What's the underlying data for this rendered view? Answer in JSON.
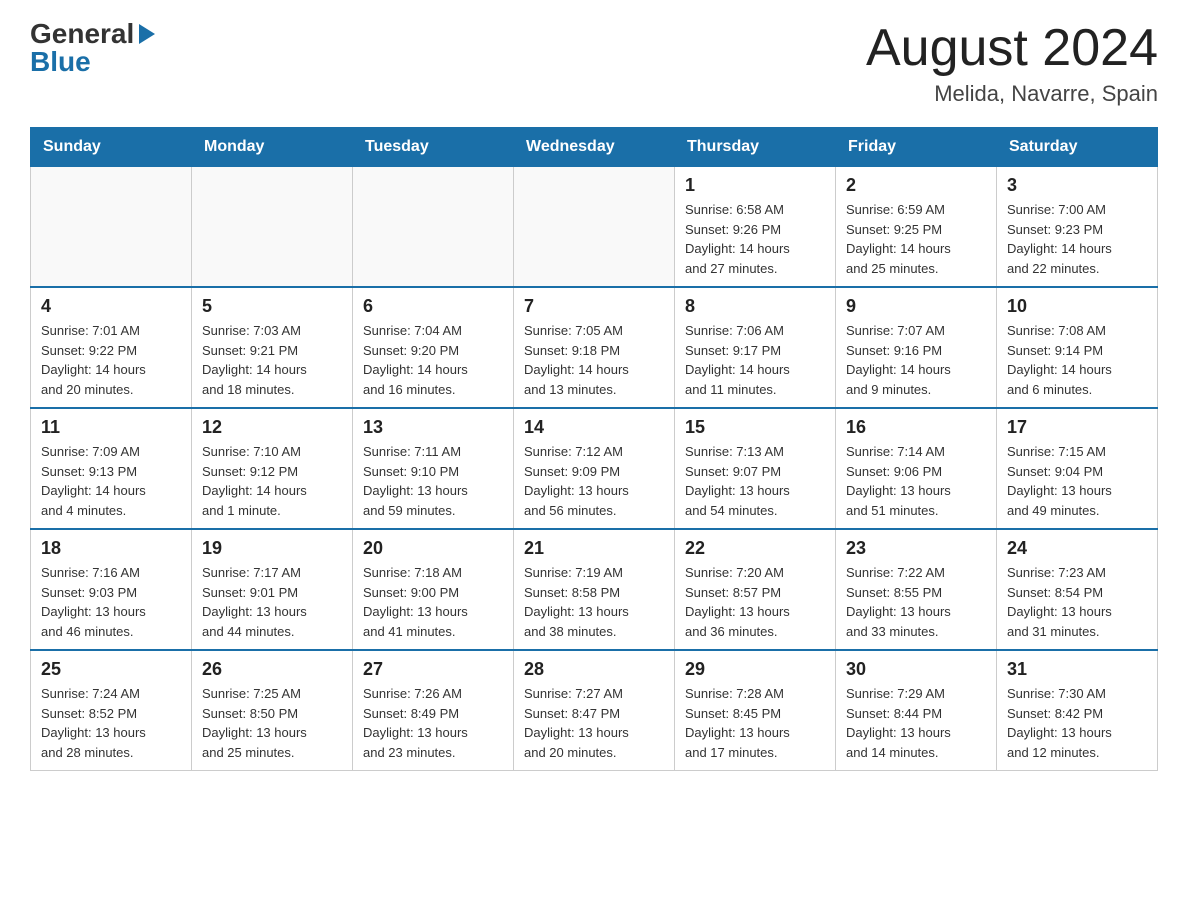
{
  "header": {
    "logo": {
      "general": "General",
      "blue": "Blue"
    },
    "title": "August 2024",
    "location": "Melida, Navarre, Spain"
  },
  "weekdays": [
    "Sunday",
    "Monday",
    "Tuesday",
    "Wednesday",
    "Thursday",
    "Friday",
    "Saturday"
  ],
  "weeks": [
    [
      {
        "day": "",
        "info": ""
      },
      {
        "day": "",
        "info": ""
      },
      {
        "day": "",
        "info": ""
      },
      {
        "day": "",
        "info": ""
      },
      {
        "day": "1",
        "info": "Sunrise: 6:58 AM\nSunset: 9:26 PM\nDaylight: 14 hours\nand 27 minutes."
      },
      {
        "day": "2",
        "info": "Sunrise: 6:59 AM\nSunset: 9:25 PM\nDaylight: 14 hours\nand 25 minutes."
      },
      {
        "day": "3",
        "info": "Sunrise: 7:00 AM\nSunset: 9:23 PM\nDaylight: 14 hours\nand 22 minutes."
      }
    ],
    [
      {
        "day": "4",
        "info": "Sunrise: 7:01 AM\nSunset: 9:22 PM\nDaylight: 14 hours\nand 20 minutes."
      },
      {
        "day": "5",
        "info": "Sunrise: 7:03 AM\nSunset: 9:21 PM\nDaylight: 14 hours\nand 18 minutes."
      },
      {
        "day": "6",
        "info": "Sunrise: 7:04 AM\nSunset: 9:20 PM\nDaylight: 14 hours\nand 16 minutes."
      },
      {
        "day": "7",
        "info": "Sunrise: 7:05 AM\nSunset: 9:18 PM\nDaylight: 14 hours\nand 13 minutes."
      },
      {
        "day": "8",
        "info": "Sunrise: 7:06 AM\nSunset: 9:17 PM\nDaylight: 14 hours\nand 11 minutes."
      },
      {
        "day": "9",
        "info": "Sunrise: 7:07 AM\nSunset: 9:16 PM\nDaylight: 14 hours\nand 9 minutes."
      },
      {
        "day": "10",
        "info": "Sunrise: 7:08 AM\nSunset: 9:14 PM\nDaylight: 14 hours\nand 6 minutes."
      }
    ],
    [
      {
        "day": "11",
        "info": "Sunrise: 7:09 AM\nSunset: 9:13 PM\nDaylight: 14 hours\nand 4 minutes."
      },
      {
        "day": "12",
        "info": "Sunrise: 7:10 AM\nSunset: 9:12 PM\nDaylight: 14 hours\nand 1 minute."
      },
      {
        "day": "13",
        "info": "Sunrise: 7:11 AM\nSunset: 9:10 PM\nDaylight: 13 hours\nand 59 minutes."
      },
      {
        "day": "14",
        "info": "Sunrise: 7:12 AM\nSunset: 9:09 PM\nDaylight: 13 hours\nand 56 minutes."
      },
      {
        "day": "15",
        "info": "Sunrise: 7:13 AM\nSunset: 9:07 PM\nDaylight: 13 hours\nand 54 minutes."
      },
      {
        "day": "16",
        "info": "Sunrise: 7:14 AM\nSunset: 9:06 PM\nDaylight: 13 hours\nand 51 minutes."
      },
      {
        "day": "17",
        "info": "Sunrise: 7:15 AM\nSunset: 9:04 PM\nDaylight: 13 hours\nand 49 minutes."
      }
    ],
    [
      {
        "day": "18",
        "info": "Sunrise: 7:16 AM\nSunset: 9:03 PM\nDaylight: 13 hours\nand 46 minutes."
      },
      {
        "day": "19",
        "info": "Sunrise: 7:17 AM\nSunset: 9:01 PM\nDaylight: 13 hours\nand 44 minutes."
      },
      {
        "day": "20",
        "info": "Sunrise: 7:18 AM\nSunset: 9:00 PM\nDaylight: 13 hours\nand 41 minutes."
      },
      {
        "day": "21",
        "info": "Sunrise: 7:19 AM\nSunset: 8:58 PM\nDaylight: 13 hours\nand 38 minutes."
      },
      {
        "day": "22",
        "info": "Sunrise: 7:20 AM\nSunset: 8:57 PM\nDaylight: 13 hours\nand 36 minutes."
      },
      {
        "day": "23",
        "info": "Sunrise: 7:22 AM\nSunset: 8:55 PM\nDaylight: 13 hours\nand 33 minutes."
      },
      {
        "day": "24",
        "info": "Sunrise: 7:23 AM\nSunset: 8:54 PM\nDaylight: 13 hours\nand 31 minutes."
      }
    ],
    [
      {
        "day": "25",
        "info": "Sunrise: 7:24 AM\nSunset: 8:52 PM\nDaylight: 13 hours\nand 28 minutes."
      },
      {
        "day": "26",
        "info": "Sunrise: 7:25 AM\nSunset: 8:50 PM\nDaylight: 13 hours\nand 25 minutes."
      },
      {
        "day": "27",
        "info": "Sunrise: 7:26 AM\nSunset: 8:49 PM\nDaylight: 13 hours\nand 23 minutes."
      },
      {
        "day": "28",
        "info": "Sunrise: 7:27 AM\nSunset: 8:47 PM\nDaylight: 13 hours\nand 20 minutes."
      },
      {
        "day": "29",
        "info": "Sunrise: 7:28 AM\nSunset: 8:45 PM\nDaylight: 13 hours\nand 17 minutes."
      },
      {
        "day": "30",
        "info": "Sunrise: 7:29 AM\nSunset: 8:44 PM\nDaylight: 13 hours\nand 14 minutes."
      },
      {
        "day": "31",
        "info": "Sunrise: 7:30 AM\nSunset: 8:42 PM\nDaylight: 13 hours\nand 12 minutes."
      }
    ]
  ]
}
